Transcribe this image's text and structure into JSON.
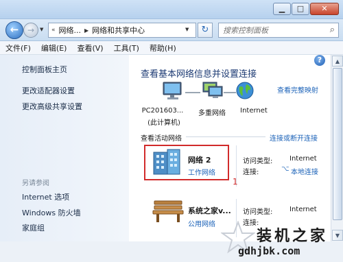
{
  "titlebar": {
    "minimize_icon": "minimize-icon",
    "maximize_icon": "maximize-icon",
    "close_icon": "close-icon"
  },
  "address_bar": {
    "breadcrumbs": [
      "网络...",
      "网络和共享中心"
    ],
    "search_placeholder": "搜索控制面板"
  },
  "menu": [
    "文件(F)",
    "编辑(E)",
    "查看(V)",
    "工具(T)",
    "帮助(H)"
  ],
  "sidebar": {
    "links": [
      "控制面板主页",
      "更改适配器设置",
      "更改高级共享设置"
    ],
    "see_also_title": "另请参阅",
    "see_also": [
      "Internet 选项",
      "Windows 防火墙",
      "家庭组"
    ]
  },
  "main": {
    "title": "查看基本网络信息并设置连接",
    "full_map_link": "查看完整映射",
    "map": {
      "computer_label": "PC201603...",
      "computer_sub": "(此计算机)",
      "network_label": "多重网络",
      "internet_label": "Internet"
    },
    "active_networks_title": "查看活动网络",
    "connect_link": "连接或断开连接",
    "networks": [
      {
        "name": "网络  2",
        "type": "工作网络",
        "access_label": "访问类型:",
        "access_value": "Internet",
        "conn_label": "连接:",
        "conn_value": "本地连接"
      },
      {
        "name": "系统之家v...",
        "type": "公用网络",
        "access_label": "访问类型:",
        "access_value": "Internet",
        "conn_label": "连接:",
        "conn_value": ""
      }
    ],
    "annotation_number": "1"
  },
  "watermark": {
    "text": "装机之家",
    "url": "gdhjbk.com"
  },
  "colors": {
    "link": "#1b62b8",
    "heading": "#1c3a73",
    "highlight": "#d12a2a"
  }
}
